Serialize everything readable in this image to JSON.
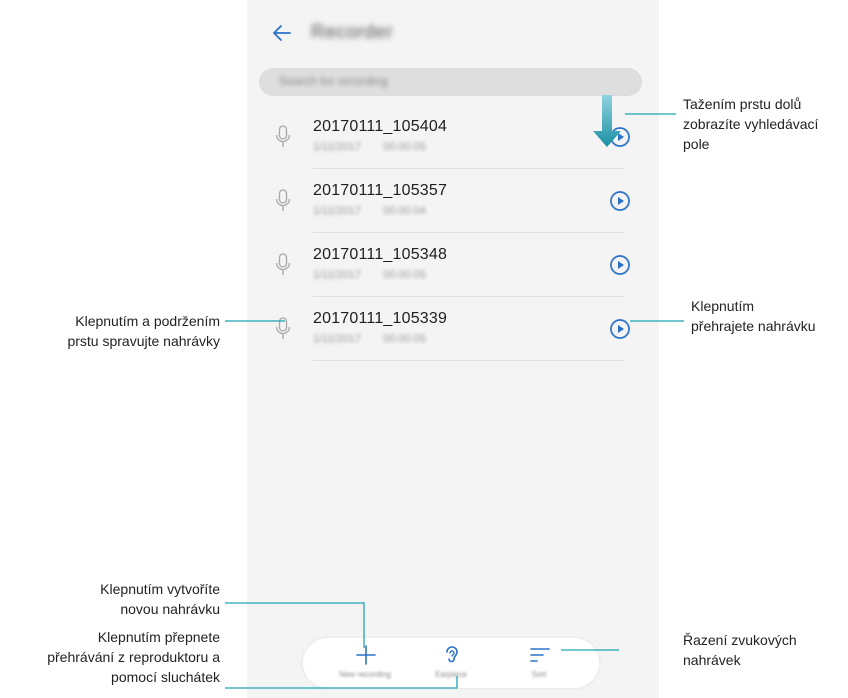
{
  "app": {
    "title": "Recorder"
  },
  "search": {
    "placeholder": "Search for recording"
  },
  "recordings": [
    {
      "name": "20170111_105404",
      "date": "1/11/2017",
      "duration": "00:00:05"
    },
    {
      "name": "20170111_105357",
      "date": "1/11/2017",
      "duration": "00:00:04"
    },
    {
      "name": "20170111_105348",
      "date": "1/11/2017",
      "duration": "00:00:05"
    },
    {
      "name": "20170111_105339",
      "date": "1/11/2017",
      "duration": "00:00:05"
    }
  ],
  "bottom_bar": {
    "new_label": "New recording",
    "earpiece_label": "Earpiece",
    "sort_label": "Sort"
  },
  "annotations": {
    "pull_down": [
      "Tažením prstu dolů",
      "zobrazíte vyhledávací",
      "pole"
    ],
    "long_press": [
      "Klepnutím a podržením",
      "prstu spravujte nahrávky"
    ],
    "play": [
      "Klepnutím",
      "přehrajete nahrávku"
    ],
    "new_recording": [
      "Klepnutím vytvoříte",
      "novou nahrávku"
    ],
    "earpiece": [
      "Klepnutím přepnete",
      "přehrávání z reproduktoru a",
      "pomocí sluchátek"
    ],
    "sort": [
      "Řazení zvukových",
      "nahrávek"
    ]
  },
  "colors": {
    "accent": "#2b72c9",
    "callout_line": "#1fa3b5",
    "background": "#f4f4f4"
  },
  "icons": {
    "back": "arrow-left",
    "mic": "microphone",
    "play": "play-circle",
    "new": "plus",
    "earpiece": "ear",
    "sort": "sort-lines",
    "pull": "arrow-down"
  }
}
